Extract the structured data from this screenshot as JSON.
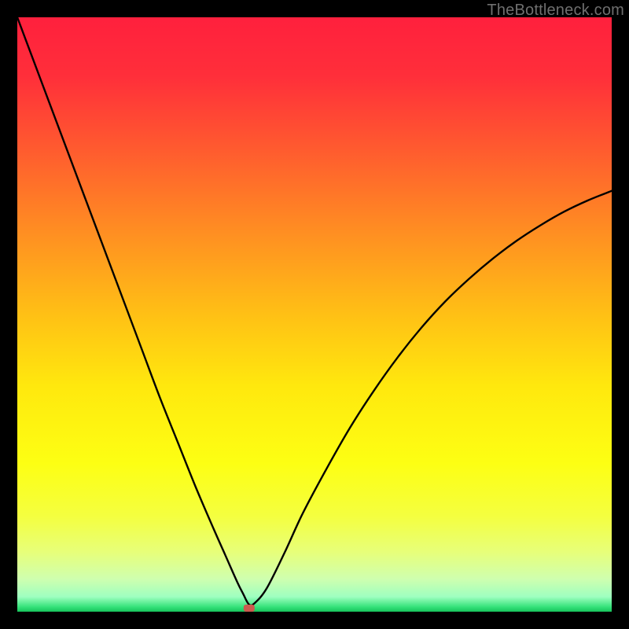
{
  "watermark": {
    "text": "TheBottleneck.com"
  },
  "chart_data": {
    "type": "line",
    "title": "",
    "xlabel": "",
    "ylabel": "",
    "xlim": [
      0,
      100
    ],
    "ylim": [
      0,
      100
    ],
    "x": [
      0,
      3,
      6,
      9,
      12,
      15,
      18,
      21,
      24,
      27,
      30,
      33,
      35,
      37,
      38,
      39,
      40,
      42,
      45,
      48,
      52,
      56,
      60,
      64,
      68,
      72,
      76,
      80,
      84,
      88,
      92,
      96,
      100
    ],
    "values": [
      100,
      92,
      84,
      76,
      68,
      60,
      52,
      44,
      36,
      28.5,
      21,
      14,
      9.5,
      5,
      3,
      1.2,
      1.5,
      4,
      10,
      16.5,
      24,
      31,
      37.2,
      42.8,
      47.8,
      52.2,
      56,
      59.4,
      62.4,
      65,
      67.3,
      69.2,
      70.8
    ],
    "marker": {
      "x": 39,
      "y": 0.6
    },
    "gradient_stops": [
      {
        "offset": 0.0,
        "color": "#ff203d"
      },
      {
        "offset": 0.1,
        "color": "#ff2f3a"
      },
      {
        "offset": 0.22,
        "color": "#ff5a2f"
      },
      {
        "offset": 0.35,
        "color": "#ff8a23"
      },
      {
        "offset": 0.5,
        "color": "#ffc015"
      },
      {
        "offset": 0.62,
        "color": "#ffe80e"
      },
      {
        "offset": 0.75,
        "color": "#fdff13"
      },
      {
        "offset": 0.84,
        "color": "#f4ff40"
      },
      {
        "offset": 0.9,
        "color": "#e7ff7a"
      },
      {
        "offset": 0.945,
        "color": "#cfffaf"
      },
      {
        "offset": 0.975,
        "color": "#9effc0"
      },
      {
        "offset": 0.992,
        "color": "#35e27a"
      },
      {
        "offset": 1.0,
        "color": "#17c35b"
      }
    ],
    "marker_color": "#cc5a4e"
  }
}
